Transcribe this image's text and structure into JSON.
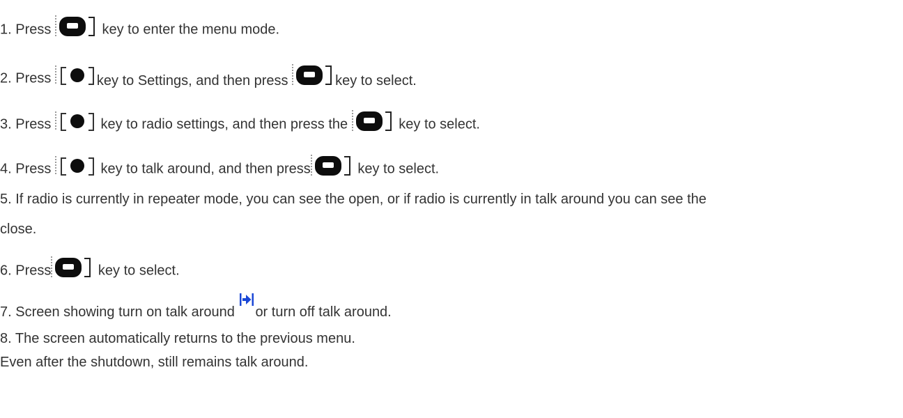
{
  "steps": [
    {
      "pre": "1. Press ",
      "post": " key to enter the menu mode."
    },
    {
      "pre": "2. Press ",
      "mid": "key to Settings, and then press ",
      "post": "key to select."
    },
    {
      "pre": "3. Press ",
      "mid": " key to radio settings, and then press the ",
      "post": " key to select."
    },
    {
      "pre": "4. Press ",
      "mid": " key to talk around, and then press",
      "post": " key to select."
    },
    {
      "line1": "5. If radio is currently in repeater mode, you can see the open, or if radio is currently in talk around you can see the",
      "line2": "close."
    },
    {
      "pre": "6. Press",
      "post": " key to select."
    },
    {
      "pre": "7. Screen showing turn on talk around ",
      "post": "or turn off talk around."
    },
    {
      "text": "8. The screen automatically returns to the previous menu."
    }
  ],
  "note": "Even after the shutdown, still remains talk around.",
  "icons": {
    "menu_key": "menu-ok-key-icon",
    "nav_key": "navigation-key-icon",
    "talk_around": "talk-around-arrow-icon"
  },
  "colors": {
    "text": "#333333",
    "talk_icon": "#1a47d6"
  }
}
